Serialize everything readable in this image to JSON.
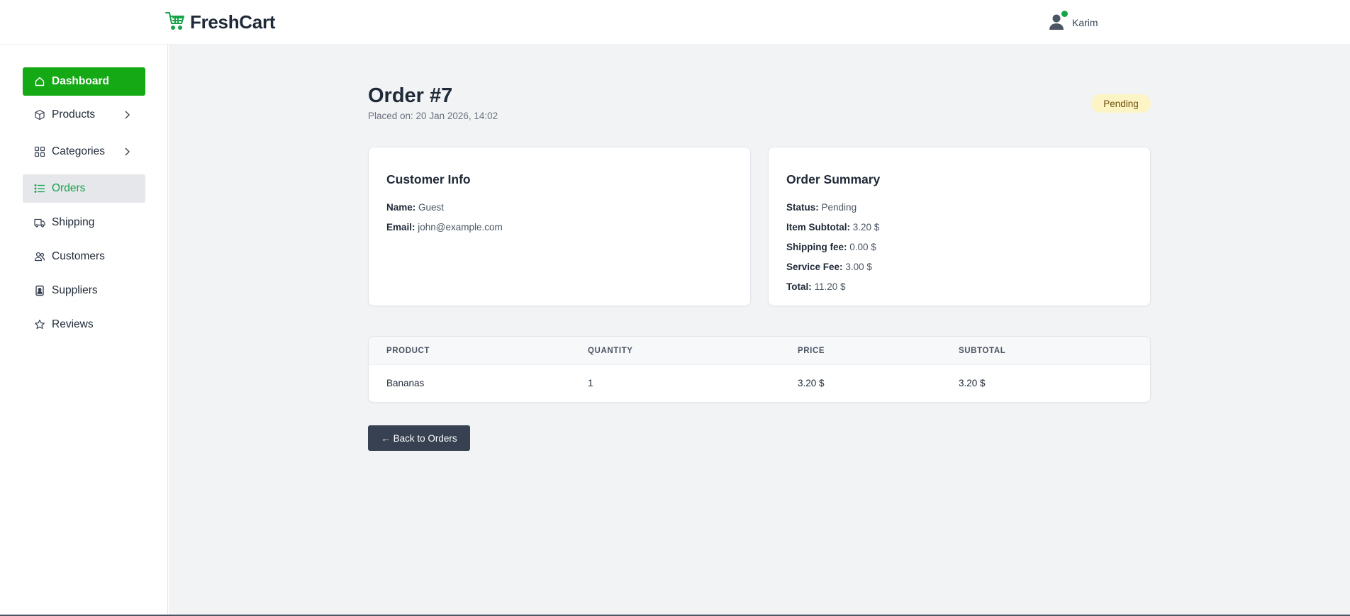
{
  "brand": {
    "name": "FreshCart",
    "accent": "#16a916"
  },
  "user": {
    "name": "Karim",
    "status_color": "#16a34a"
  },
  "sidebar": {
    "items": [
      {
        "label": "Dashboard",
        "icon": "home-icon",
        "state": "active"
      },
      {
        "label": "Products",
        "icon": "box-icon",
        "has_submenu": true
      },
      {
        "label": "Categories",
        "icon": "grid-icon",
        "has_submenu": true
      },
      {
        "label": "Orders",
        "icon": "list-icon",
        "state": "selected"
      },
      {
        "label": "Shipping",
        "icon": "truck-icon"
      },
      {
        "label": "Customers",
        "icon": "users-icon"
      },
      {
        "label": "Suppliers",
        "icon": "id-badge-icon"
      },
      {
        "label": "Reviews",
        "icon": "star-icon"
      }
    ]
  },
  "order": {
    "title": "Order #7",
    "placed": "Placed on: 20 Jan 2026, 14:02",
    "status_badge": "Pending"
  },
  "customer_info": {
    "title": "Customer Info",
    "name_label": "Name:",
    "name": "Guest",
    "email_label": "Email:",
    "email": "john@example.com"
  },
  "order_summary": {
    "title": "Order Summary",
    "status_label": "Status:",
    "status": "Pending",
    "item_subtotal_label": "Item Subtotal:",
    "item_subtotal": "3.20 $",
    "shipping_fee_label": "Shipping fee:",
    "shipping_fee": "0.00 $",
    "service_fee_label": "Service Fee:",
    "service_fee": "3.00 $",
    "total_label": "Total:",
    "total": "11.20 $"
  },
  "items_table": {
    "headers": [
      "PRODUCT",
      "QUANTITY",
      "PRICE",
      "SUBTOTAL"
    ],
    "rows": [
      [
        "Bananas",
        "1",
        "3.20 $",
        "3.20 $"
      ]
    ]
  },
  "back_button": "← Back to Orders"
}
